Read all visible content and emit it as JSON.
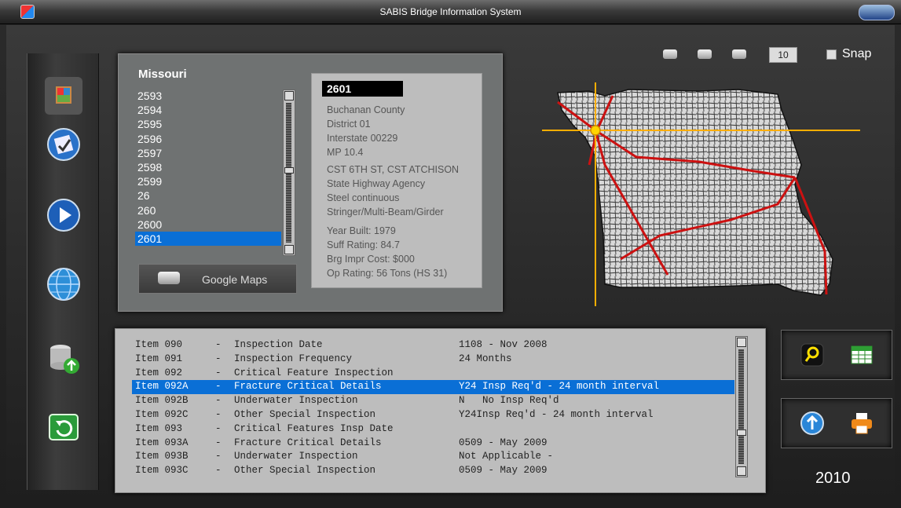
{
  "window": {
    "title": "SABIS Bridge Information System"
  },
  "state_name": "Missouri",
  "structure_list": {
    "items": [
      "2593",
      "2594",
      "2595",
      "2596",
      "2597",
      "2598",
      "2599",
      "26",
      "260",
      "2600",
      "2601"
    ],
    "selected": "2601"
  },
  "google_maps_label": "Google Maps",
  "bridge": {
    "id": "2601",
    "county": "Buchanan County",
    "district": "District 01",
    "route": "Interstate 00229",
    "mp": "MP 10.4",
    "feature": "CST 6TH ST, CST ATCHISON",
    "owner": "State Highway Agency",
    "material": "Steel continuous",
    "design": "Stringer/Multi-Beam/Girder",
    "year_built": "Year Built: 1979",
    "suff_rating": "Suff Rating: 84.7",
    "brg_cost": "Brg Impr Cost: $000",
    "op_rating": "Op Rating: 56 Tons (HS 31)"
  },
  "map_controls": {
    "count": "10",
    "snap_label": "Snap"
  },
  "inspection_items": [
    {
      "item": "Item 090",
      "dash": "-",
      "desc": "Inspection Date",
      "value": "1108 - Nov 2008"
    },
    {
      "item": "Item 091",
      "dash": "-",
      "desc": "Inspection Frequency",
      "value": "24 Months"
    },
    {
      "item": "Item 092",
      "dash": "-",
      "desc": "Critical Feature Inspection",
      "value": ""
    },
    {
      "item": "Item 092A",
      "dash": "-",
      "desc": "Fracture Critical Details",
      "value": "Y24 Insp Req'd - 24 month interval"
    },
    {
      "item": "Item 092B",
      "dash": "-",
      "desc": "Underwater Inspection",
      "value": "N   No Insp Req'd"
    },
    {
      "item": "Item 092C",
      "dash": "-",
      "desc": "Other Special Inspection",
      "value": "Y24Insp Req'd - 24 month interval"
    },
    {
      "item": "Item 093",
      "dash": "-",
      "desc": "Critical Features Insp Date",
      "value": ""
    },
    {
      "item": "Item 093A",
      "dash": "-",
      "desc": "Fracture Critical Details",
      "value": "0509 - May 2009"
    },
    {
      "item": "Item 093B",
      "dash": "-",
      "desc": "Underwater Inspection",
      "value": "Not Applicable -"
    },
    {
      "item": "Item 093C",
      "dash": "-",
      "desc": "Other Special Inspection",
      "value": "0509 - May 2009"
    }
  ],
  "selected_inspection_item": "Item 092A",
  "year_label": "2010",
  "icons": {
    "sidebar": [
      "bridge-app-icon",
      "checklist-icon",
      "play-icon",
      "globe-icon",
      "database-upload-icon",
      "refresh-icon"
    ],
    "tools": [
      "search-icon",
      "table-grid-icon",
      "upload-arrow-icon",
      "print-icon"
    ]
  },
  "colors": {
    "selection": "#0a6fd6",
    "route_lines": "#cc1111",
    "crosshair": "#ffaa00"
  }
}
